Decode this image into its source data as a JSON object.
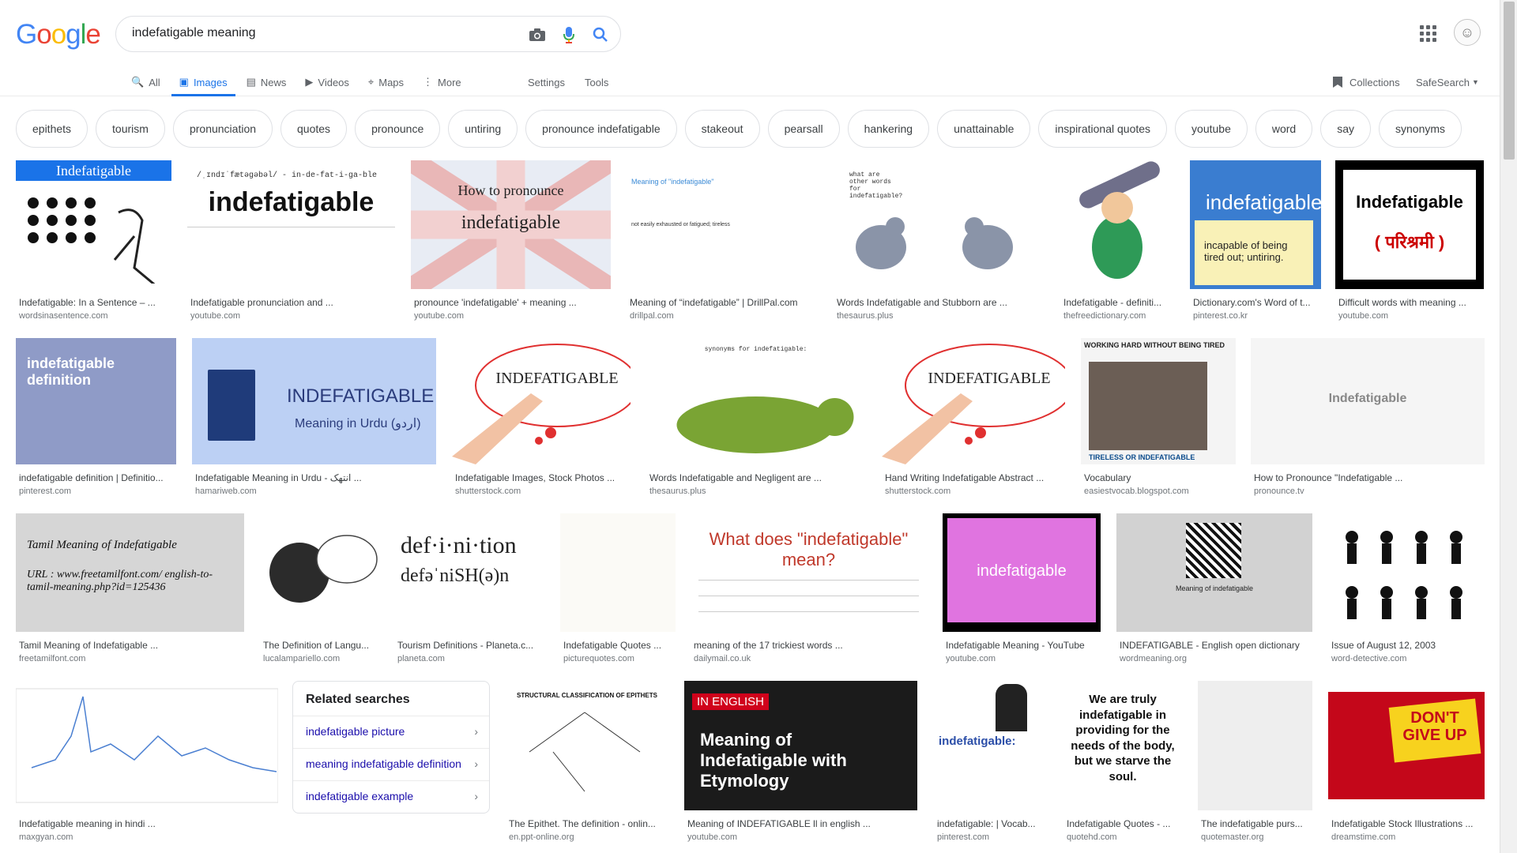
{
  "logo": {
    "letters": [
      "G",
      "o",
      "o",
      "g",
      "l",
      "e"
    ],
    "colors": [
      "#4285F4",
      "#EA4335",
      "#FBBC05",
      "#4285F4",
      "#34A853",
      "#EA4335"
    ]
  },
  "search": {
    "value": "indefatigable meaning",
    "camera_icon": "camera-icon",
    "mic_icon": "mic-icon",
    "search_icon": "search-icon"
  },
  "header": {
    "apps_icon": "apps-grid-icon",
    "avatar_icon": "avatar"
  },
  "tabs": [
    {
      "label": "All",
      "icon": "🔍"
    },
    {
      "label": "Images",
      "icon": "▣"
    },
    {
      "label": "News",
      "icon": "▤"
    },
    {
      "label": "Videos",
      "icon": "▶"
    },
    {
      "label": "Maps",
      "icon": "⌖"
    },
    {
      "label": "More",
      "icon": "⋮"
    }
  ],
  "tools": {
    "settings": "Settings",
    "tools": "Tools",
    "collections": "Collections",
    "safesearch": "SafeSearch"
  },
  "chips": [
    "epithets",
    "tourism",
    "pronunciation",
    "quotes",
    "pronounce",
    "untiring",
    "pronounce indefatigable",
    "stakeout",
    "pearsall",
    "hankering",
    "unattainable",
    "inspirational quotes",
    "youtube",
    "word",
    "say",
    "synonyms"
  ],
  "results": [
    {
      "caption": "Indefatigable: In a Sentence – ...",
      "source": "wordsinasentence.com",
      "thumb_text": "Indefatigable"
    },
    {
      "caption": "Indefatigable pronunciation and ...",
      "source": "youtube.com",
      "thumb_text": "indefatigable",
      "thumb_sub": "/ˌɪndɪˈfætəɡəbəl/ - in-de-fat-i-ga-ble"
    },
    {
      "caption": "pronounce 'indefatigable' + meaning ...",
      "source": "youtube.com",
      "thumb_text": "How to pronounce",
      "thumb_sub": "indefatigable"
    },
    {
      "caption": "Meaning of “indefatigable” | DrillPal.com",
      "source": "drillpal.com",
      "thumb_text": "Meaning of \"indefatigable\"",
      "thumb_sub": "not easily exhausted or fatigued; tireless"
    },
    {
      "caption": "Words Indefatigable and Stubborn are ...",
      "source": "thesaurus.plus",
      "thumb_text": "what are other words for indefatigable?"
    },
    {
      "caption": "Indefatigable - definiti...",
      "source": "thefreedictionary.com"
    },
    {
      "caption": "Dictionary.com's Word of t...",
      "source": "pinterest.co.kr",
      "thumb_text": "indefatigable",
      "thumb_sub": "incapable of being tired out; untiring."
    },
    {
      "caption": "Difficult words with meaning ...",
      "source": "youtube.com",
      "thumb_text": "Indefatigable",
      "thumb_sub": "( परिश्रमी )"
    },
    {
      "caption": "indefatigable definition | Definitio...",
      "source": "pinterest.com",
      "thumb_text": "indefatigable definition"
    },
    {
      "caption": "Indefatigable Meaning in Urdu - انتھک ...",
      "source": "hamariweb.com",
      "thumb_text": "INDEFATIGABLE",
      "thumb_sub": "Meaning in Urdu (اردو)"
    },
    {
      "caption": "Indefatigable Images, Stock Photos ...",
      "source": "shutterstock.com",
      "thumb_text": "INDEFATIGABLE"
    },
    {
      "caption": "Words Indefatigable and Negligent are ...",
      "source": "thesaurus.plus",
      "thumb_text": "synonyms for indefatigable:"
    },
    {
      "caption": "Hand Writing Indefatigable Abstract ...",
      "source": "shutterstock.com",
      "thumb_text": "INDEFATIGABLE"
    },
    {
      "caption": "Vocabulary",
      "source": "easiestvocab.blogspot.com",
      "thumb_text": "WORKING HARD WITHOUT BEING TIRED",
      "thumb_sub": "TIRELESS OR INDEFATIGABLE"
    },
    {
      "caption": "How to Pronounce \"Indefatigable ...",
      "source": "pronounce.tv",
      "thumb_text": "Indefatigable"
    },
    {
      "caption": "Tamil Meaning of Indefatigable ...",
      "source": "freetamilfont.com",
      "thumb_text": "Tamil Meaning of Indefatigable",
      "thumb_sub": "URL : www.freetamilfont.com/ english-to-tamil-meaning.php?id=125436"
    },
    {
      "caption": "The Definition of Langu...",
      "source": "lucalampariello.com"
    },
    {
      "caption": "Tourism Definitions - Planeta.c...",
      "source": "planeta.com",
      "thumb_text": "def·i·ni·tion",
      "thumb_sub": "defəˈniSH(ə)n"
    },
    {
      "caption": "Indefatigable Quotes ...",
      "source": "picturequotes.com"
    },
    {
      "caption": "meaning of the 17 trickiest words ...",
      "source": "dailymail.co.uk",
      "thumb_text": "What does \"indefatigable\" mean?"
    },
    {
      "caption": "Indefatigable Meaning - YouTube",
      "source": "youtube.com",
      "thumb_text": "indefatigable"
    },
    {
      "caption": "INDEFATIGABLE - English open dictionary",
      "source": "wordmeaning.org",
      "thumb_text": "Meaning of indefatigable"
    },
    {
      "caption": "Issue of August 12, 2003",
      "source": "word-detective.com"
    },
    {
      "caption": "Indefatigable meaning in hindi ...",
      "source": "maxgyan.com"
    },
    {
      "caption": "The Epithet. The definition - onlin...",
      "source": "en.ppt-online.org",
      "thumb_text": "STRUCTURAL CLASSIFICATION OF EPITHETS"
    },
    {
      "caption": "Meaning of INDEFATIGABLE ll in english ...",
      "source": "youtube.com",
      "thumb_text": "Meaning of Indefatigable with Etymology",
      "thumb_sub": "IN ENGLISH"
    },
    {
      "caption": "indefatigable: | Vocab...",
      "source": "pinterest.com",
      "thumb_text": "indefatigable:"
    },
    {
      "caption": "Indefatigable Quotes - ...",
      "source": "quotehd.com",
      "thumb_text": "We are truly indefatigable in providing for the needs of the body, but we starve the soul."
    },
    {
      "caption": "The indefatigable purs...",
      "source": "quotemaster.org"
    },
    {
      "caption": "Indefatigable Stock Illustrations ...",
      "source": "dreamstime.com",
      "thumb_text": "DON'T GIVE UP"
    }
  ],
  "related": {
    "title": "Related searches",
    "items": [
      "indefatigable picture",
      "meaning indefatigable definition",
      "indefatigable example"
    ]
  }
}
